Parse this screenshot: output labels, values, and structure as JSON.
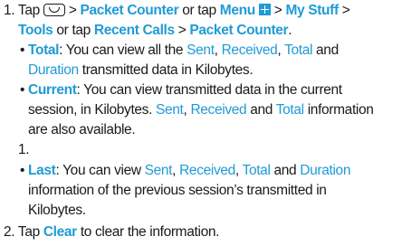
{
  "accent": "#1f9bd6",
  "step1": {
    "number": "1.",
    "tap": "Tap",
    "key_icon": "end-key-icon",
    "packet_counter": "Packet Counter",
    "or_tap": "or tap",
    "menu": "Menu",
    "menu_icon": "menu-grid-icon",
    "my_stuff": "My Stuff",
    "tools": "Tools",
    "recent_calls": "Recent Calls",
    "packet_counter_2": "Packet Counter",
    "gt": ">",
    "period": "."
  },
  "total": {
    "label": "Total",
    "t1": ": You can view all the",
    "sent": "Sent",
    "received": "Received",
    "total": "Total",
    "and": "and",
    "duration": "Duration",
    "t2": "transmitted data in Kilobytes."
  },
  "current": {
    "label": "Current",
    "t1": ": You can view transmitted data in the current",
    "t2": "session, in Kilobytes.",
    "sent": "Sent",
    "received": "Received",
    "and": "and",
    "total": "Total",
    "t3": "information",
    "t4": "are also available."
  },
  "last_step": {
    "number": "1.",
    "label": "Last",
    "t1": ": You can view",
    "sent": "Sent",
    "received": "Received",
    "total": "Total",
    "and": "and",
    "duration": "Duration",
    "t2": "information of the previous session’s transmitted in",
    "t3": "Kilobytes."
  },
  "step2": {
    "number": "2.",
    "tap": "Tap",
    "clear": "Clear",
    "rest": "to clear the information."
  }
}
